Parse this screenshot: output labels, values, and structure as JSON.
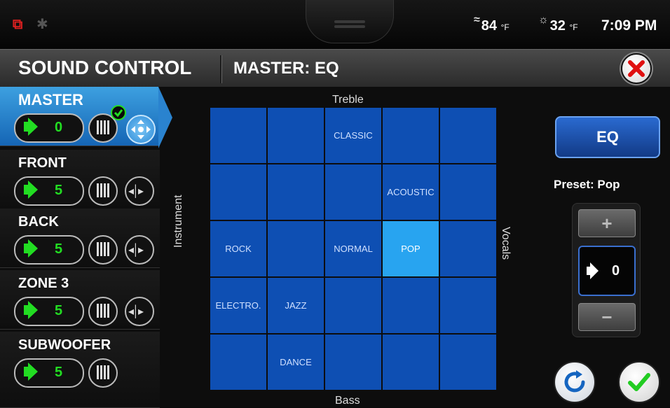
{
  "status": {
    "temp_indoor": "84",
    "temp_outdoor": "32",
    "unit": "°F",
    "time": "7:09 PM"
  },
  "header": {
    "title": "SOUND CONTROL",
    "subtitle": "MASTER: EQ"
  },
  "zones": [
    {
      "name": "MASTER",
      "volume": "0",
      "active": true
    },
    {
      "name": "FRONT",
      "volume": "5"
    },
    {
      "name": "BACK",
      "volume": "5"
    },
    {
      "name": "ZONE 3",
      "volume": "5"
    },
    {
      "name": "SUBWOOFER",
      "volume": "5"
    }
  ],
  "eq_grid": {
    "top_label": "Treble",
    "bottom_label": "Bass",
    "left_label": "Instrument",
    "right_label": "Vocals",
    "cells": [
      "",
      "",
      "CLASSIC",
      "",
      "",
      "",
      "",
      "",
      "ACOUSTIC",
      "",
      "ROCK",
      "",
      "NORMAL",
      "POP",
      "",
      "ELECTRO.",
      "JAZZ",
      "",
      "",
      "",
      "",
      "DANCE",
      "",
      "",
      ""
    ],
    "selected_index": 13
  },
  "right_panel": {
    "eq_button": "EQ",
    "preset_label": "Preset:",
    "preset_value": "Pop",
    "stepper_value": "0"
  },
  "colors": {
    "grid_cell": "#0e4fb3",
    "grid_selected": "#28a4f0",
    "active_zone": "#2a83cf",
    "volume_green": "#22dd22"
  }
}
